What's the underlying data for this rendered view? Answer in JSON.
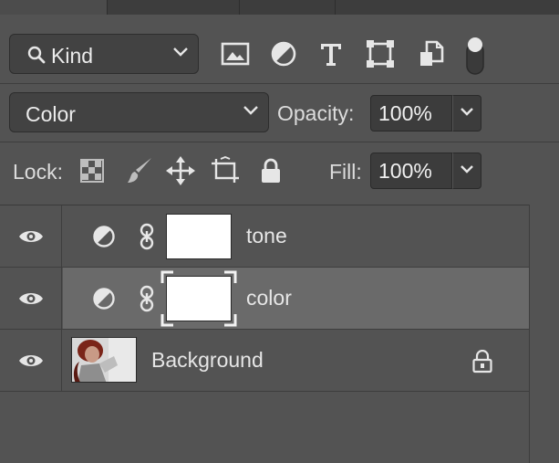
{
  "filter": {
    "kind_label": "Kind",
    "icons": [
      "image-filter-icon",
      "adjustment-filter-icon",
      "type-filter-icon",
      "shape-filter-icon",
      "smart-object-filter-icon",
      "filter-toggle"
    ]
  },
  "blend": {
    "mode_label": "Color",
    "opacity_label": "Opacity:",
    "opacity_value": "100%"
  },
  "lock": {
    "label": "Lock:",
    "fill_label": "Fill:",
    "fill_value": "100%",
    "icons": [
      "lock-transparent-pixels-icon",
      "lock-image-pixels-icon",
      "lock-position-icon",
      "lock-artboard-icon",
      "lock-all-icon"
    ]
  },
  "layers": [
    {
      "name": "tone",
      "type": "adjustment",
      "visible": true,
      "selected": false
    },
    {
      "name": "color",
      "type": "adjustment",
      "visible": true,
      "selected": true
    },
    {
      "name": "Background",
      "type": "pixel",
      "visible": true,
      "selected": false,
      "locked": true
    }
  ],
  "colors": {
    "panel_bg": "#535353",
    "selected_row": "#6a6a6a",
    "field_bg": "#424242",
    "text": "#e6e6e6"
  }
}
